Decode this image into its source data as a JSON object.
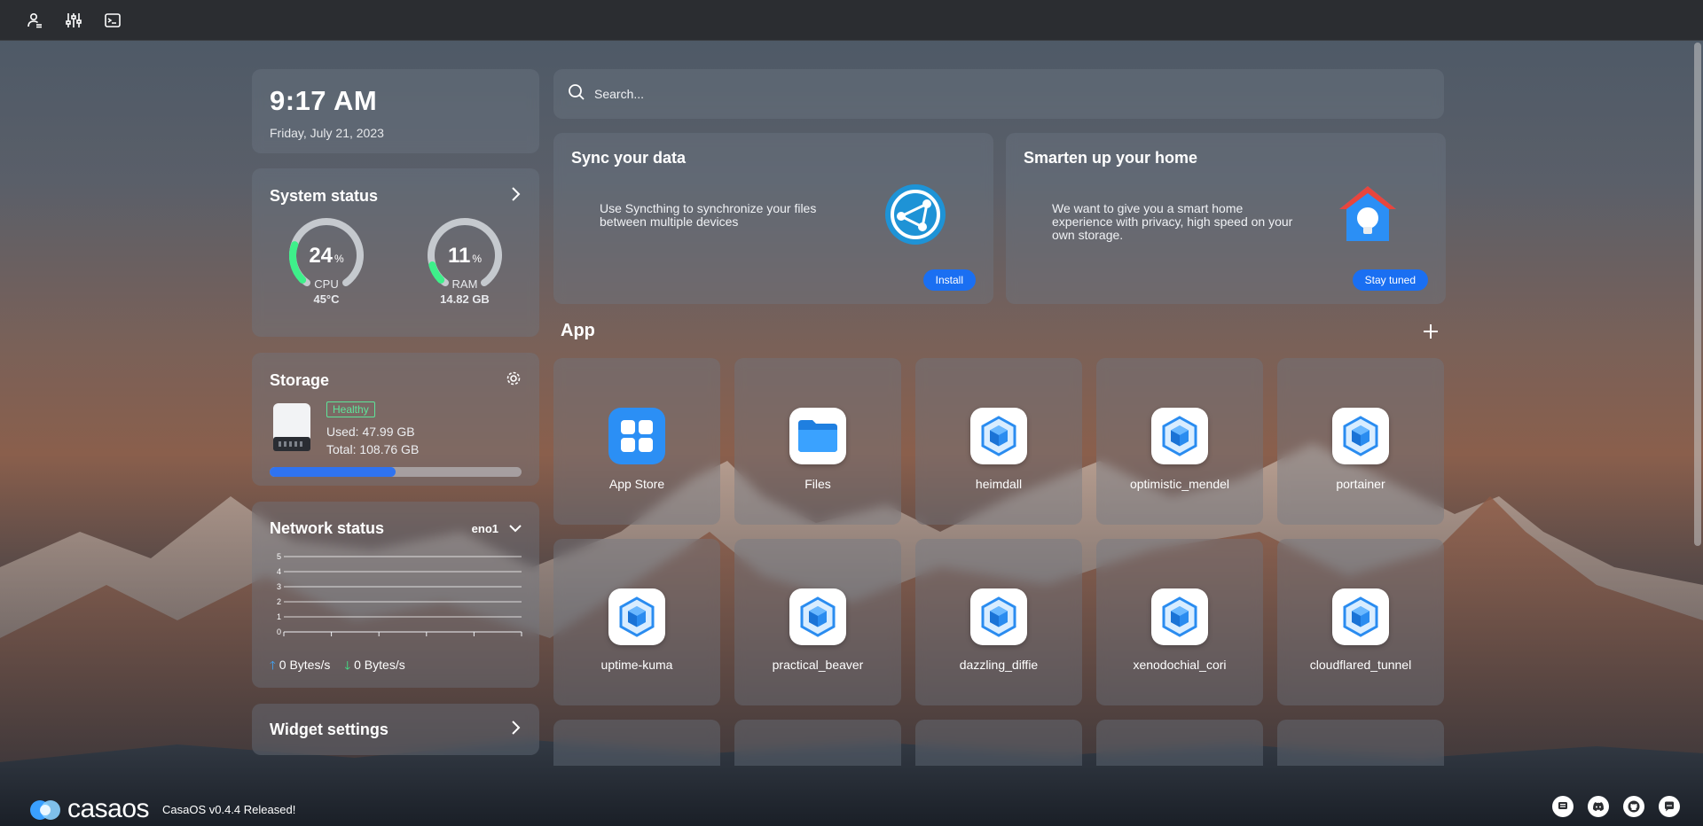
{
  "topbar": {
    "icons": [
      "account-settings-icon",
      "sliders-icon",
      "terminal-icon"
    ]
  },
  "clock": {
    "time": "9:17 AM",
    "date": "Friday, July 21, 2023"
  },
  "system_status": {
    "title": "System status",
    "cpu": {
      "value": "24",
      "unit": "%",
      "label": "CPU",
      "sub": "45°C",
      "fraction": 0.24
    },
    "ram": {
      "value": "11",
      "unit": "%",
      "label": "RAM",
      "sub": "14.82 GB",
      "fraction": 0.11
    }
  },
  "storage": {
    "title": "Storage",
    "status": "Healthy",
    "used": "Used: 47.99 GB",
    "total": "Total: 108.76 GB",
    "usage_fraction": 0.5
  },
  "network": {
    "title": "Network status",
    "interface": "eno1",
    "y_ticks": [
      "5",
      "4",
      "3",
      "2",
      "1",
      "0"
    ],
    "upload": "0 Bytes/s",
    "download": "0 Bytes/s"
  },
  "widget_settings": {
    "title": "Widget settings"
  },
  "search": {
    "placeholder": "Search..."
  },
  "promos": [
    {
      "title": "Sync your data",
      "text": "Use Syncthing to synchronize your files between multiple devices",
      "button": "Install",
      "icon": "syncthing-icon"
    },
    {
      "title": "Smarten up your home",
      "text": "We want to give you a smart home experience with privacy, high speed on your own storage.",
      "button": "Stay tuned",
      "icon": "smart-home-icon"
    }
  ],
  "apps": {
    "title": "App",
    "items": [
      {
        "name": "App Store",
        "icon": "app-store-icon"
      },
      {
        "name": "Files",
        "icon": "folder-icon"
      },
      {
        "name": "heimdall",
        "icon": "cube-icon"
      },
      {
        "name": "optimistic_mendel",
        "icon": "cube-icon"
      },
      {
        "name": "portainer",
        "icon": "cube-icon"
      },
      {
        "name": "uptime-kuma",
        "icon": "cube-icon"
      },
      {
        "name": "practical_beaver",
        "icon": "cube-icon"
      },
      {
        "name": "dazzling_diffie",
        "icon": "cube-icon"
      },
      {
        "name": "xenodochial_cori",
        "icon": "cube-icon"
      },
      {
        "name": "cloudflared_tunnel",
        "icon": "cube-icon"
      }
    ]
  },
  "footer": {
    "logo_text": "casaos",
    "release": "CasaOS v0.4.4 Released!",
    "social": [
      "feedback-icon",
      "discord-icon",
      "github-icon",
      "chat-icon"
    ]
  },
  "colors": {
    "accent": "#1a6ff2",
    "gauge_green": "#3ef08a",
    "healthy": "#5ee59a"
  }
}
